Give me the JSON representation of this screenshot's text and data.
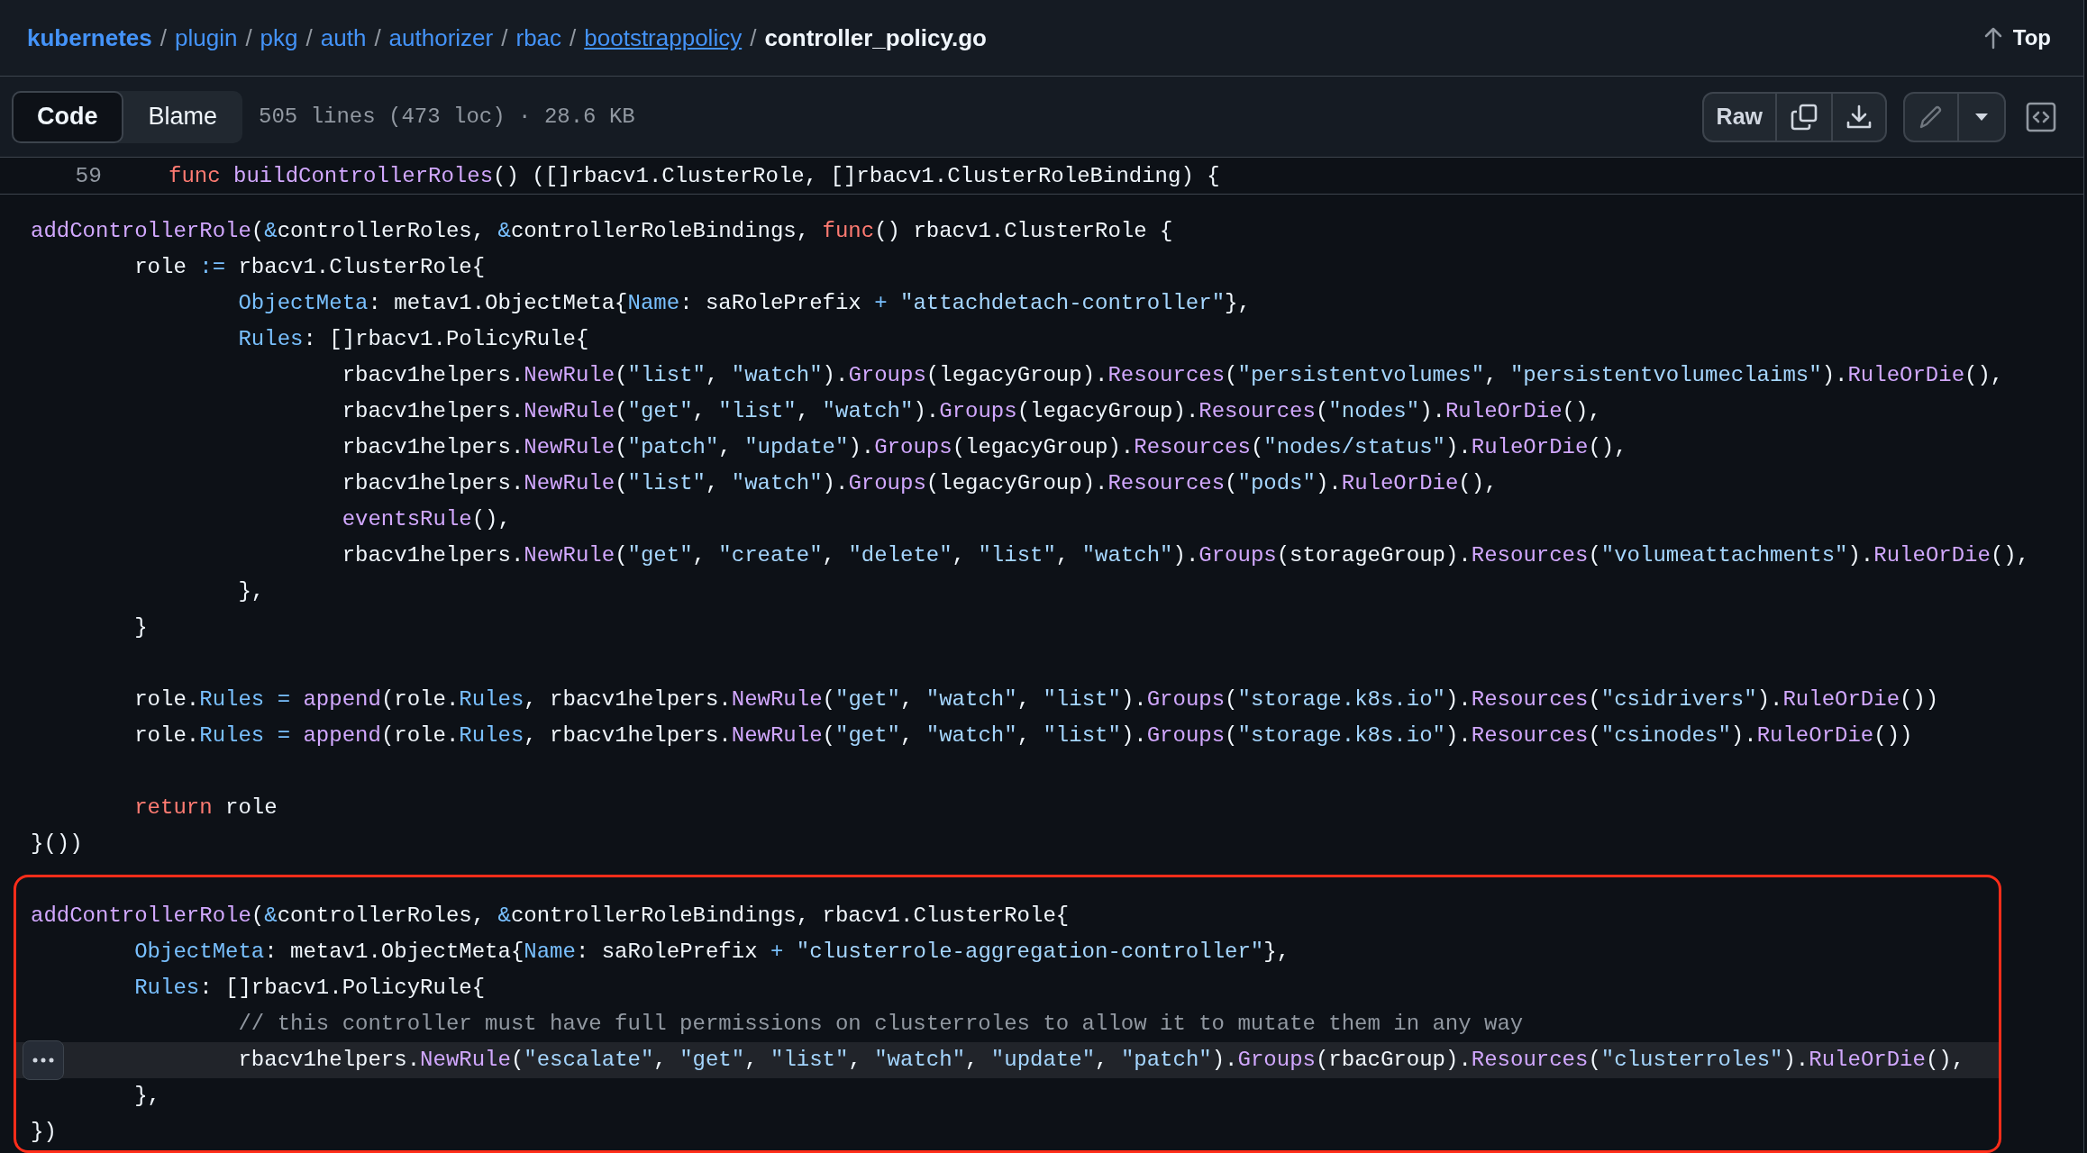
{
  "breadcrumb": [
    {
      "text": "kubernetes",
      "kind": "root",
      "hovered": false
    },
    {
      "text": "plugin",
      "kind": "dir",
      "before": "/",
      "hovered": false
    },
    {
      "text": "pkg",
      "kind": "dir",
      "before": "/",
      "hovered": false
    },
    {
      "text": "auth",
      "kind": "dir",
      "before": "/",
      "hovered": false
    },
    {
      "text": "authorizer",
      "kind": "dir",
      "before": "/",
      "hovered": false
    },
    {
      "text": "rbac",
      "kind": "dir",
      "before": "/",
      "hovered": false
    },
    {
      "text": "bootstrappolicy",
      "kind": "dir",
      "before": "/",
      "hovered": true
    },
    {
      "text": "controller_policy.go",
      "kind": "file",
      "before": "/",
      "hovered": false
    }
  ],
  "top_link": {
    "label": "Top"
  },
  "view_tabs": [
    {
      "label": "Code",
      "selected": true
    },
    {
      "label": "Blame",
      "selected": false
    }
  ],
  "file_info": "505 lines (473 loc) · 28.6 KB",
  "raw_button": {
    "label": "Raw"
  },
  "edit_button": {
    "disabled": true
  },
  "sticky_line": {
    "number": "59",
    "tokens": [
      {
        "kind": "k",
        "text": "func "
      },
      {
        "kind": "f",
        "text": "buildControllerRoles"
      },
      {
        "kind": "t",
        "text": "() ([]rbacv1.ClusterRole, []rbacv1.ClusterRoleBinding) {"
      }
    ]
  },
  "sections": [
    {
      "framed": false,
      "lines": [
        {
          "kind": "code",
          "highlighted": false,
          "tokens": [
            {
              "kind": "f",
              "text": "addControllerRole"
            },
            {
              "kind": "t",
              "text": "("
            },
            {
              "kind": "c",
              "text": "&"
            },
            {
              "kind": "t",
              "text": "controllerRoles, "
            },
            {
              "kind": "c",
              "text": "&"
            },
            {
              "kind": "t",
              "text": "controllerRoleBindings, "
            },
            {
              "kind": "k",
              "text": "func"
            },
            {
              "kind": "t",
              "text": "() rbacv1.ClusterRole {"
            }
          ]
        },
        {
          "kind": "code",
          "highlighted": false,
          "tokens": [
            {
              "kind": "t",
              "text": "\trole "
            },
            {
              "kind": "c",
              "text": ":="
            },
            {
              "kind": "t",
              "text": " rbacv1.ClusterRole{"
            }
          ]
        },
        {
          "kind": "code",
          "highlighted": false,
          "tokens": [
            {
              "kind": "c",
              "text": "\t\tObjectMeta"
            },
            {
              "kind": "t",
              "text": ": metav1.ObjectMeta{"
            },
            {
              "kind": "c",
              "text": "Name"
            },
            {
              "kind": "t",
              "text": ": saRolePrefix "
            },
            {
              "kind": "c",
              "text": "+ "
            },
            {
              "kind": "s",
              "text": "\"attachdetach-controller\""
            },
            {
              "kind": "t",
              "text": "},"
            }
          ]
        },
        {
          "kind": "code",
          "highlighted": false,
          "tokens": [
            {
              "kind": "c",
              "text": "\t\tRules"
            },
            {
              "kind": "t",
              "text": ": []rbacv1.PolicyRule{"
            }
          ]
        },
        {
          "kind": "code",
          "highlighted": false,
          "tokens": [
            {
              "kind": "t",
              "text": "\t\t\trbacv1helpers."
            },
            {
              "kind": "f",
              "text": "NewRule"
            },
            {
              "kind": "t",
              "text": "("
            },
            {
              "kind": "s",
              "text": "\"list\""
            },
            {
              "kind": "t",
              "text": ", "
            },
            {
              "kind": "s",
              "text": "\"watch\""
            },
            {
              "kind": "t",
              "text": ")."
            },
            {
              "kind": "f",
              "text": "Groups"
            },
            {
              "kind": "t",
              "text": "(legacyGroup)."
            },
            {
              "kind": "f",
              "text": "Resources"
            },
            {
              "kind": "t",
              "text": "("
            },
            {
              "kind": "s",
              "text": "\"persistentvolumes\""
            },
            {
              "kind": "t",
              "text": ", "
            },
            {
              "kind": "s",
              "text": "\"persistentvolumeclaims\""
            },
            {
              "kind": "t",
              "text": ")."
            },
            {
              "kind": "f",
              "text": "RuleOrDie"
            },
            {
              "kind": "t",
              "text": "(),"
            }
          ]
        },
        {
          "kind": "code",
          "highlighted": false,
          "tokens": [
            {
              "kind": "t",
              "text": "\t\t\trbacv1helpers."
            },
            {
              "kind": "f",
              "text": "NewRule"
            },
            {
              "kind": "t",
              "text": "("
            },
            {
              "kind": "s",
              "text": "\"get\""
            },
            {
              "kind": "t",
              "text": ", "
            },
            {
              "kind": "s",
              "text": "\"list\""
            },
            {
              "kind": "t",
              "text": ", "
            },
            {
              "kind": "s",
              "text": "\"watch\""
            },
            {
              "kind": "t",
              "text": ")."
            },
            {
              "kind": "f",
              "text": "Groups"
            },
            {
              "kind": "t",
              "text": "(legacyGroup)."
            },
            {
              "kind": "f",
              "text": "Resources"
            },
            {
              "kind": "t",
              "text": "("
            },
            {
              "kind": "s",
              "text": "\"nodes\""
            },
            {
              "kind": "t",
              "text": ")."
            },
            {
              "kind": "f",
              "text": "RuleOrDie"
            },
            {
              "kind": "t",
              "text": "(),"
            }
          ]
        },
        {
          "kind": "code",
          "highlighted": false,
          "tokens": [
            {
              "kind": "t",
              "text": "\t\t\trbacv1helpers."
            },
            {
              "kind": "f",
              "text": "NewRule"
            },
            {
              "kind": "t",
              "text": "("
            },
            {
              "kind": "s",
              "text": "\"patch\""
            },
            {
              "kind": "t",
              "text": ", "
            },
            {
              "kind": "s",
              "text": "\"update\""
            },
            {
              "kind": "t",
              "text": ")."
            },
            {
              "kind": "f",
              "text": "Groups"
            },
            {
              "kind": "t",
              "text": "(legacyGroup)."
            },
            {
              "kind": "f",
              "text": "Resources"
            },
            {
              "kind": "t",
              "text": "("
            },
            {
              "kind": "s",
              "text": "\"nodes/status\""
            },
            {
              "kind": "t",
              "text": ")."
            },
            {
              "kind": "f",
              "text": "RuleOrDie"
            },
            {
              "kind": "t",
              "text": "(),"
            }
          ]
        },
        {
          "kind": "code",
          "highlighted": false,
          "tokens": [
            {
              "kind": "t",
              "text": "\t\t\trbacv1helpers."
            },
            {
              "kind": "f",
              "text": "NewRule"
            },
            {
              "kind": "t",
              "text": "("
            },
            {
              "kind": "s",
              "text": "\"list\""
            },
            {
              "kind": "t",
              "text": ", "
            },
            {
              "kind": "s",
              "text": "\"watch\""
            },
            {
              "kind": "t",
              "text": ")."
            },
            {
              "kind": "f",
              "text": "Groups"
            },
            {
              "kind": "t",
              "text": "(legacyGroup)."
            },
            {
              "kind": "f",
              "text": "Resources"
            },
            {
              "kind": "t",
              "text": "("
            },
            {
              "kind": "s",
              "text": "\"pods\""
            },
            {
              "kind": "t",
              "text": ")."
            },
            {
              "kind": "f",
              "text": "RuleOrDie"
            },
            {
              "kind": "t",
              "text": "(),"
            }
          ]
        },
        {
          "kind": "code",
          "highlighted": false,
          "tokens": [
            {
              "kind": "f",
              "text": "\t\t\teventsRule"
            },
            {
              "kind": "t",
              "text": "(),"
            }
          ]
        },
        {
          "kind": "code",
          "highlighted": false,
          "tokens": [
            {
              "kind": "t",
              "text": "\t\t\trbacv1helpers."
            },
            {
              "kind": "f",
              "text": "NewRule"
            },
            {
              "kind": "t",
              "text": "("
            },
            {
              "kind": "s",
              "text": "\"get\""
            },
            {
              "kind": "t",
              "text": ", "
            },
            {
              "kind": "s",
              "text": "\"create\""
            },
            {
              "kind": "t",
              "text": ", "
            },
            {
              "kind": "s",
              "text": "\"delete\""
            },
            {
              "kind": "t",
              "text": ", "
            },
            {
              "kind": "s",
              "text": "\"list\""
            },
            {
              "kind": "t",
              "text": ", "
            },
            {
              "kind": "s",
              "text": "\"watch\""
            },
            {
              "kind": "t",
              "text": ")."
            },
            {
              "kind": "f",
              "text": "Groups"
            },
            {
              "kind": "t",
              "text": "(storageGroup)."
            },
            {
              "kind": "f",
              "text": "Resources"
            },
            {
              "kind": "t",
              "text": "("
            },
            {
              "kind": "s",
              "text": "\"volumeattachments\""
            },
            {
              "kind": "t",
              "text": ")."
            },
            {
              "kind": "f",
              "text": "RuleOrDie"
            },
            {
              "kind": "t",
              "text": "(),"
            }
          ]
        },
        {
          "kind": "code",
          "highlighted": false,
          "tokens": [
            {
              "kind": "t",
              "text": "\t\t},"
            }
          ]
        },
        {
          "kind": "code",
          "highlighted": false,
          "tokens": [
            {
              "kind": "t",
              "text": "\t}"
            }
          ]
        },
        {
          "kind": "blank",
          "highlighted": false
        },
        {
          "kind": "code",
          "highlighted": false,
          "tokens": [
            {
              "kind": "t",
              "text": "\trole."
            },
            {
              "kind": "c",
              "text": "Rules = "
            },
            {
              "kind": "f",
              "text": "append"
            },
            {
              "kind": "t",
              "text": "(role."
            },
            {
              "kind": "c",
              "text": "Rules"
            },
            {
              "kind": "t",
              "text": ", rbacv1helpers."
            },
            {
              "kind": "f",
              "text": "NewRule"
            },
            {
              "kind": "t",
              "text": "("
            },
            {
              "kind": "s",
              "text": "\"get\""
            },
            {
              "kind": "t",
              "text": ", "
            },
            {
              "kind": "s",
              "text": "\"watch\""
            },
            {
              "kind": "t",
              "text": ", "
            },
            {
              "kind": "s",
              "text": "\"list\""
            },
            {
              "kind": "t",
              "text": ")."
            },
            {
              "kind": "f",
              "text": "Groups"
            },
            {
              "kind": "t",
              "text": "("
            },
            {
              "kind": "s",
              "text": "\"storage.k8s.io\""
            },
            {
              "kind": "t",
              "text": ")."
            },
            {
              "kind": "f",
              "text": "Resources"
            },
            {
              "kind": "t",
              "text": "("
            },
            {
              "kind": "s",
              "text": "\"csidrivers\""
            },
            {
              "kind": "t",
              "text": ")."
            },
            {
              "kind": "f",
              "text": "RuleOrDie"
            },
            {
              "kind": "t",
              "text": "())"
            }
          ]
        },
        {
          "kind": "code",
          "highlighted": false,
          "tokens": [
            {
              "kind": "t",
              "text": "\trole."
            },
            {
              "kind": "c",
              "text": "Rules = "
            },
            {
              "kind": "f",
              "text": "append"
            },
            {
              "kind": "t",
              "text": "(role."
            },
            {
              "kind": "c",
              "text": "Rules"
            },
            {
              "kind": "t",
              "text": ", rbacv1helpers."
            },
            {
              "kind": "f",
              "text": "NewRule"
            },
            {
              "kind": "t",
              "text": "("
            },
            {
              "kind": "s",
              "text": "\"get\""
            },
            {
              "kind": "t",
              "text": ", "
            },
            {
              "kind": "s",
              "text": "\"watch\""
            },
            {
              "kind": "t",
              "text": ", "
            },
            {
              "kind": "s",
              "text": "\"list\""
            },
            {
              "kind": "t",
              "text": ")."
            },
            {
              "kind": "f",
              "text": "Groups"
            },
            {
              "kind": "t",
              "text": "("
            },
            {
              "kind": "s",
              "text": "\"storage.k8s.io\""
            },
            {
              "kind": "t",
              "text": ")."
            },
            {
              "kind": "f",
              "text": "Resources"
            },
            {
              "kind": "t",
              "text": "("
            },
            {
              "kind": "s",
              "text": "\"csinodes\""
            },
            {
              "kind": "t",
              "text": ")."
            },
            {
              "kind": "f",
              "text": "RuleOrDie"
            },
            {
              "kind": "t",
              "text": "())"
            }
          ]
        },
        {
          "kind": "blank",
          "highlighted": false
        },
        {
          "kind": "code",
          "highlighted": false,
          "tokens": [
            {
              "kind": "k",
              "text": "\treturn"
            },
            {
              "kind": "t",
              "text": " role"
            }
          ]
        },
        {
          "kind": "code",
          "highlighted": false,
          "tokens": [
            {
              "kind": "t",
              "text": "}())"
            }
          ]
        }
      ]
    },
    {
      "framed": true,
      "lines": [
        {
          "kind": "code",
          "highlighted": false,
          "tokens": [
            {
              "kind": "f",
              "text": "addControllerRole"
            },
            {
              "kind": "t",
              "text": "("
            },
            {
              "kind": "c",
              "text": "&"
            },
            {
              "kind": "t",
              "text": "controllerRoles, "
            },
            {
              "kind": "c",
              "text": "&"
            },
            {
              "kind": "t",
              "text": "controllerRoleBindings, rbacv1.ClusterRole{"
            }
          ]
        },
        {
          "kind": "code",
          "highlighted": false,
          "tokens": [
            {
              "kind": "c",
              "text": "\tObjectMeta"
            },
            {
              "kind": "t",
              "text": ": metav1.ObjectMeta{"
            },
            {
              "kind": "c",
              "text": "Name"
            },
            {
              "kind": "t",
              "text": ": saRolePrefix "
            },
            {
              "kind": "c",
              "text": "+ "
            },
            {
              "kind": "s",
              "text": "\"clusterrole-aggregation-controller\""
            },
            {
              "kind": "t",
              "text": "},"
            }
          ]
        },
        {
          "kind": "code",
          "highlighted": false,
          "tokens": [
            {
              "kind": "c",
              "text": "\tRules"
            },
            {
              "kind": "t",
              "text": ": []rbacv1.PolicyRule{"
            }
          ]
        },
        {
          "kind": "code",
          "highlighted": false,
          "tokens": [
            {
              "kind": "m",
              "text": "\t\t// this controller must have full permissions on clusterroles to allow it to mutate them in any way"
            }
          ]
        },
        {
          "kind": "code",
          "highlighted": true,
          "tokens": [
            {
              "kind": "t",
              "text": "\t\trbacv1helpers."
            },
            {
              "kind": "f",
              "text": "NewRule"
            },
            {
              "kind": "t",
              "text": "("
            },
            {
              "kind": "s",
              "text": "\"escalate\""
            },
            {
              "kind": "t",
              "text": ", "
            },
            {
              "kind": "s",
              "text": "\"get\""
            },
            {
              "kind": "t",
              "text": ", "
            },
            {
              "kind": "s",
              "text": "\"list\""
            },
            {
              "kind": "t",
              "text": ", "
            },
            {
              "kind": "s",
              "text": "\"watch\""
            },
            {
              "kind": "t",
              "text": ", "
            },
            {
              "kind": "s",
              "text": "\"update\""
            },
            {
              "kind": "t",
              "text": ", "
            },
            {
              "kind": "s",
              "text": "\"patch\""
            },
            {
              "kind": "t",
              "text": ")."
            },
            {
              "kind": "f",
              "text": "Groups"
            },
            {
              "kind": "t",
              "text": "(rbacGroup)."
            },
            {
              "kind": "f",
              "text": "Resources"
            },
            {
              "kind": "t",
              "text": "("
            },
            {
              "kind": "s",
              "text": "\"clusterroles\""
            },
            {
              "kind": "t",
              "text": ")."
            },
            {
              "kind": "f",
              "text": "RuleOrDie"
            },
            {
              "kind": "t",
              "text": "(),"
            }
          ]
        },
        {
          "kind": "code",
          "highlighted": false,
          "tokens": [
            {
              "kind": "t",
              "text": "\t},"
            }
          ]
        },
        {
          "kind": "code",
          "highlighted": false,
          "tokens": [
            {
              "kind": "t",
              "text": "})"
            }
          ]
        }
      ]
    }
  ]
}
